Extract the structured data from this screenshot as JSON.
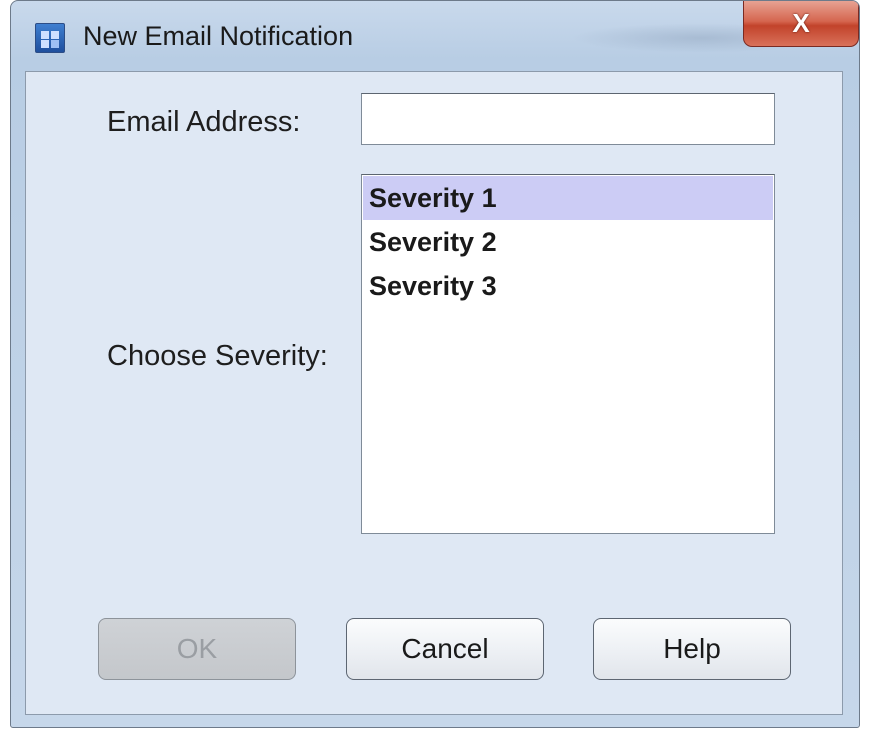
{
  "window": {
    "title": "New Email Notification",
    "close_glyph": "X"
  },
  "form": {
    "email_label": "Email Address:",
    "email_value": "",
    "severity_label": "Choose Severity:",
    "severity_options": [
      {
        "label": "Severity 1",
        "selected": true
      },
      {
        "label": "Severity 2",
        "selected": false
      },
      {
        "label": "Severity 3",
        "selected": false
      }
    ]
  },
  "buttons": {
    "ok_label": "OK",
    "ok_enabled": false,
    "cancel_label": "Cancel",
    "help_label": "Help"
  },
  "colors": {
    "selection": "#ccccf5",
    "close_button": "#c2432b",
    "dialog_background": "#dfe8f4"
  },
  "icons": {
    "app": "app-window-icon",
    "close": "close-icon"
  }
}
